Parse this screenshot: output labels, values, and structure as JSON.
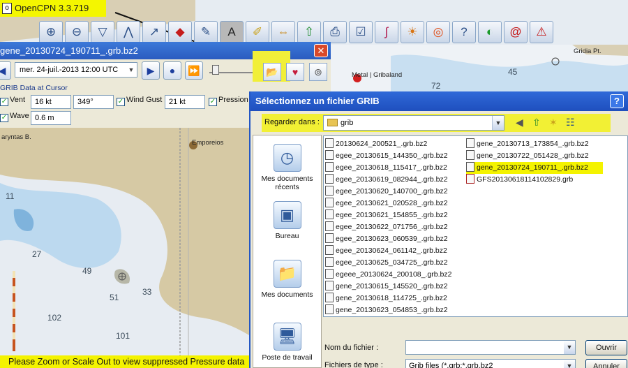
{
  "app": {
    "title": "OpenCPN 3.3.719"
  },
  "toolbar": {
    "buttons": [
      "zoom-in",
      "zoom-out",
      "route",
      "waypoint",
      "track",
      "sail",
      "tools",
      "text",
      "pencil",
      "tide",
      "current",
      "print",
      "settings",
      "waves",
      "sunset",
      "lifebuoy",
      "help",
      "gauge",
      "spiral",
      "alarm"
    ]
  },
  "chart": {
    "labels": {
      "grida": "Gridia Pt.",
      "metal": "Metal | Gribaland",
      "aryntas": "aryntas B.",
      "emporeios": "Emporeios"
    },
    "depths": [
      "72",
      "45",
      "11",
      "27",
      "49",
      "51",
      "33",
      "102",
      "101"
    ],
    "status": "Please Zoom or Scale Out to view suppressed Pressure data"
  },
  "grib": {
    "title": "gene_20130724_190711_.grb.bz2",
    "date": "mer. 24-juil.-2013 12:00  UTC",
    "cursor_label": "GRIB Data at Cursor",
    "vent_label": "Vent",
    "vent_speed": "16 kt",
    "vent_dir": "349°",
    "gust_label": "Wind Gust",
    "gust_value": "21 kt",
    "pressure_label": "Pression",
    "wave_label": "Wave",
    "wave_value": "0.6 m"
  },
  "file_dialog": {
    "title": "Sélectionnez un fichier GRIB",
    "lookin_label": "Regarder dans :",
    "lookin_value": "grib",
    "places": [
      "Mes documents récents",
      "Bureau",
      "Mes documents",
      "Poste de travail"
    ],
    "files_col1": [
      "20130624_200521_.grb.bz2",
      "egee_20130615_144350_.grb.bz2",
      "egee_20130618_115417_.grb.bz2",
      "egee_20130619_082944_.grb.bz2",
      "egee_20130620_140700_.grb.bz2",
      "egee_20130621_020528_.grb.bz2",
      "egee_20130621_154855_.grb.bz2",
      "egee_20130622_071756_.grb.bz2",
      "egee_20130623_060539_.grb.bz2",
      "egee_20130624_061142_.grb.bz2",
      "egee_20130625_034725_.grb.bz2",
      "egeee_20130624_200108_.grb.bz2",
      "gene_20130615_145520_.grb.bz2",
      "gene_20130618_114725_.grb.bz2",
      "gene_20130623_054853_.grb.bz2"
    ],
    "files_col2": [
      "gene_20130713_173854_.grb.bz2",
      "gene_20130722_051428_.grb.bz2",
      "gene_20130724_190711_.grb.bz2",
      "GFS20130618114102829.grb"
    ],
    "selected_file": "gene_20130724_190711_.grb.bz2",
    "filename_label": "Nom du fichier :",
    "filename_value": "",
    "filetype_label": "Fichiers de type :",
    "filetype_value": "Grib files (*.grb;*.grb.bz2",
    "open_label": "Ouvrir",
    "cancel_label": "Annuler"
  },
  "colors": {
    "highlight": "#f4f300",
    "land": "#d6c9a4",
    "shallow": "#bcd9ef",
    "sea": "#e9eef4"
  }
}
